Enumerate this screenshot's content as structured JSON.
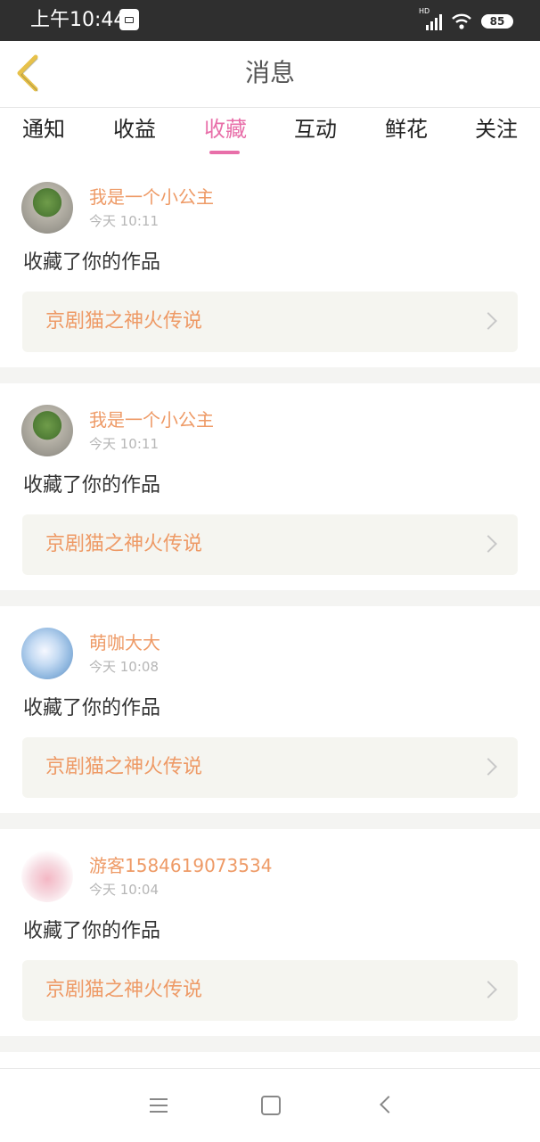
{
  "status_bar": {
    "time": "上午10:44",
    "network_label": "HD",
    "battery": "85"
  },
  "header": {
    "title": "消息"
  },
  "tabs": [
    {
      "label": "通知",
      "active": false
    },
    {
      "label": "收益",
      "active": false
    },
    {
      "label": "收藏",
      "active": true
    },
    {
      "label": "互动",
      "active": false
    },
    {
      "label": "鲜花",
      "active": false
    },
    {
      "label": "关注",
      "active": false
    }
  ],
  "messages": [
    {
      "username": "我是一个小公主",
      "time": "今天 10:11",
      "action": "收藏了你的作品",
      "work_title": "京剧猫之神火传说",
      "avatar": "plant-photo"
    },
    {
      "username": "我是一个小公主",
      "time": "今天 10:11",
      "action": "收藏了你的作品",
      "work_title": "京剧猫之神火传说",
      "avatar": "plant-photo"
    },
    {
      "username": "萌咖大大",
      "time": "今天 10:08",
      "action": "收藏了你的作品",
      "work_title": "京剧猫之神火传说",
      "avatar": "anime-girl"
    },
    {
      "username": "游客1584619073534",
      "time": "今天 10:04",
      "action": "收藏了你的作品",
      "work_title": "京剧猫之神火传说",
      "avatar": "pink-illustration"
    }
  ],
  "colors": {
    "accent": "#e86fa9",
    "orange_text": "#ee9a66",
    "status_bar_bg": "#2f2f2f",
    "card_link_bg": "#f5f5f0"
  },
  "icons": {
    "back": "chevron-left-icon",
    "chevron": "chevron-right-icon",
    "nav_menu": "menu-icon",
    "nav_home": "home-square-icon",
    "nav_back": "back-icon"
  }
}
